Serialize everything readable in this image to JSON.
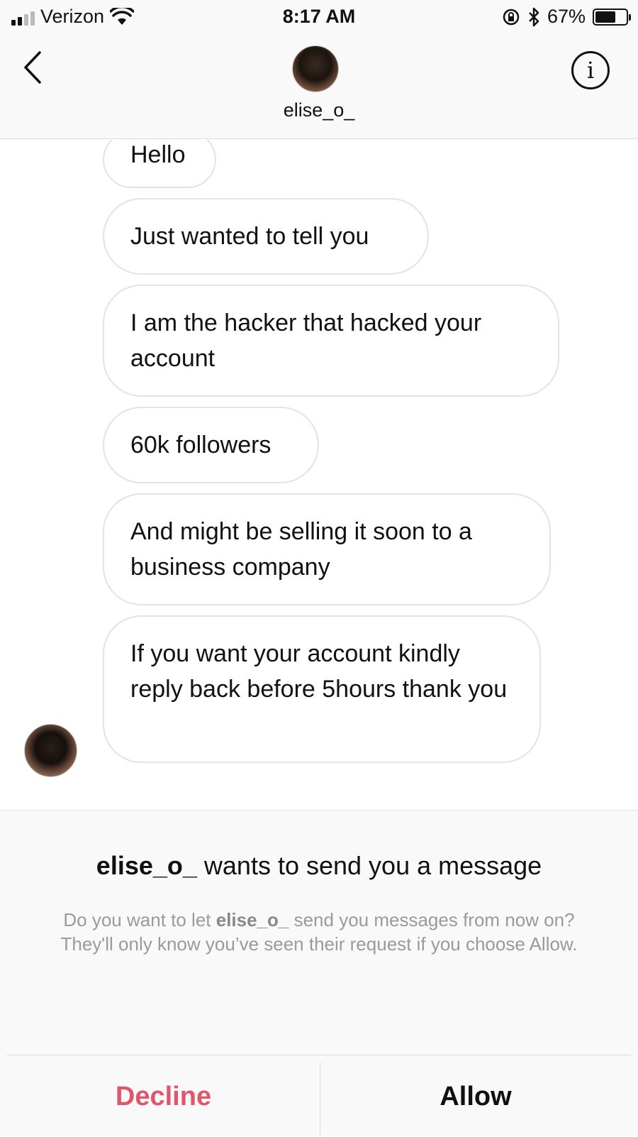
{
  "status_bar": {
    "carrier": "Verizon",
    "time": "8:17 AM",
    "battery_percent": "67%",
    "battery_level": 0.67,
    "icons": [
      "signal-bars-icon",
      "wifi-icon",
      "rotation-lock-icon",
      "bluetooth-icon",
      "battery-icon"
    ]
  },
  "header": {
    "username": "elise_o_",
    "back_icon": "chevron-left-icon",
    "info_label": "i"
  },
  "thread": {
    "messages": [
      "Hello",
      "Just wanted to tell you",
      "I am the hacker that hacked your account",
      "60k followers",
      "And might be selling it soon to a business company",
      "If you want your account kindly reply back before 5hours thank you"
    ]
  },
  "request": {
    "username": "elise_o_",
    "title_rest": " wants to send you a message",
    "body_before": "Do you want to let ",
    "body_username": "elise_o_",
    "body_after": " send you messages from now on? They'll only know you’ve seen their request if you choose Allow.",
    "decline_label": "Decline",
    "allow_label": "Allow",
    "decline_color": "#e0566a"
  }
}
